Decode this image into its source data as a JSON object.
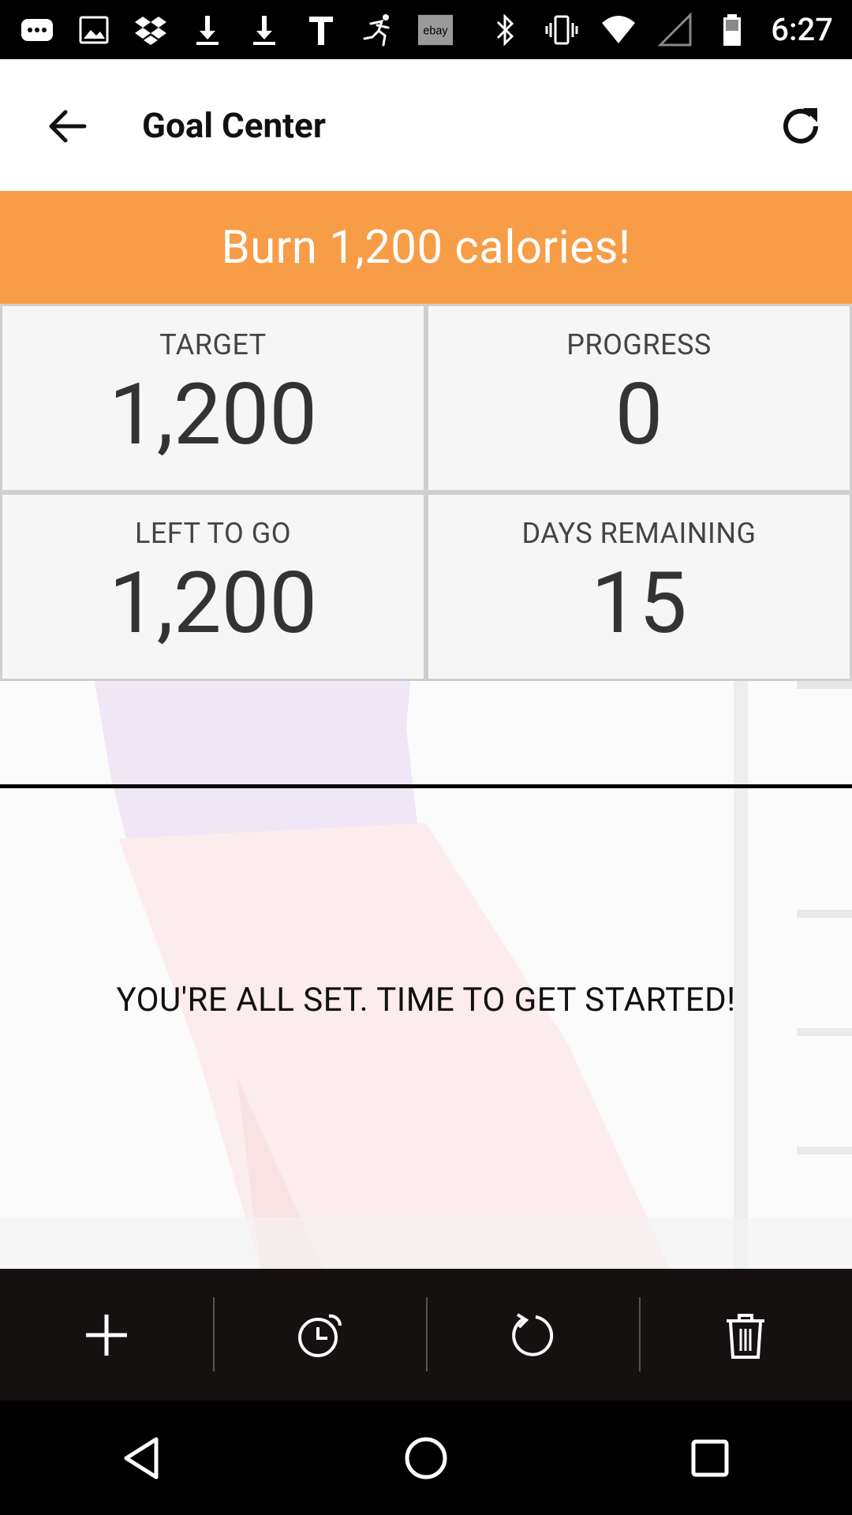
{
  "status_bar": {
    "time": "6:27",
    "left_icons": [
      "chat-icon",
      "image-icon",
      "dropbox-icon",
      "download-icon",
      "download-icon",
      "text-icon",
      "runner-icon",
      "ebay-icon"
    ],
    "ebay_text": "ebay",
    "right_icons": [
      "bluetooth-icon",
      "vibrate-icon",
      "wifi-icon",
      "signal-icon",
      "battery-icon"
    ]
  },
  "app_bar": {
    "title": "Goal Center",
    "back_icon": "arrow-left-icon",
    "refresh_icon": "refresh-icon"
  },
  "banner": {
    "text": "Burn 1,200 calories!",
    "color": "#F79D47"
  },
  "stats": {
    "target": {
      "label": "TARGET",
      "value": "1,200"
    },
    "progress": {
      "label": "PROGRESS",
      "value": "0"
    },
    "left_to_go": {
      "label": "LEFT TO GO",
      "value": "1,200"
    },
    "days_remaining": {
      "label": "DAYS REMAINING",
      "value": "15"
    }
  },
  "hero": {
    "message": "YOU'RE ALL SET. TIME TO GET STARTED!"
  },
  "toolbar": {
    "items": [
      "plus-icon",
      "alarm-clock-icon",
      "reset-icon",
      "trash-icon"
    ]
  },
  "nav_bar": {
    "items": [
      "back-triangle-icon",
      "home-circle-icon",
      "recents-square-icon"
    ]
  }
}
